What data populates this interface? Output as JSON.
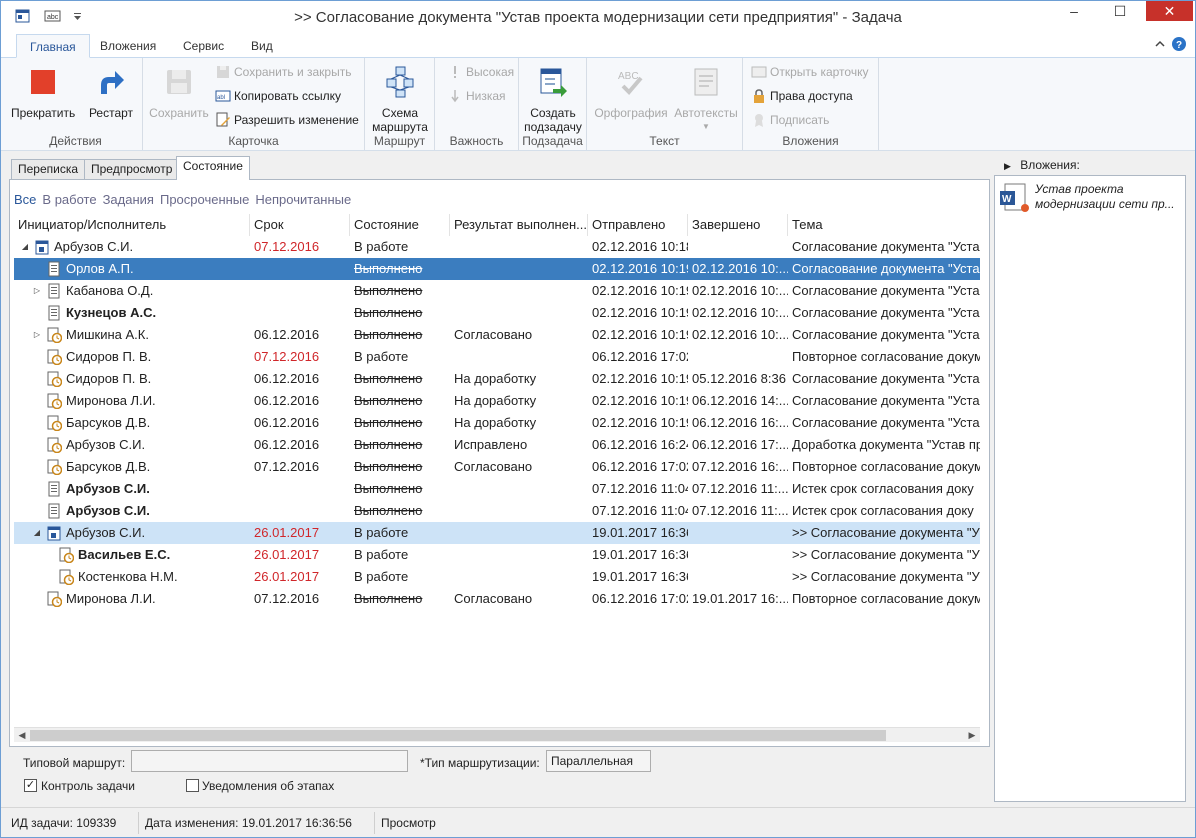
{
  "window": {
    "title": ">> Согласование документа \"Устав проекта модернизации сети предприятия\" - Задача",
    "minimize": "–",
    "maximize": "☐",
    "close": "✕"
  },
  "ribbon_tabs": [
    "Главная",
    "Вложения",
    "Сервис",
    "Вид"
  ],
  "ribbon": {
    "groups": {
      "actions": "Действия",
      "card": "Карточка",
      "route": "Маршрут",
      "importance": "Важность",
      "subtask": "Подзадача",
      "text": "Текст",
      "attachments": "Вложения"
    },
    "stop": "Прекратить",
    "restart": "Рестарт",
    "save": "Сохранить",
    "save_close": "Сохранить и закрыть",
    "copy_link": "Копировать ссылку",
    "allow_change": "Разрешить изменение",
    "route_scheme_1": "Схема",
    "route_scheme_2": "маршрута",
    "high": "Высокая",
    "low": "Низкая",
    "create_sub_1": "Создать",
    "create_sub_2": "подзадачу",
    "spelling": "Орфография",
    "autotext": "Автотексты",
    "open_card": "Открыть карточку",
    "access": "Права доступа",
    "sign": "Подписать"
  },
  "doc_tabs": [
    "Переписка",
    "Предпросмотр",
    "Состояние"
  ],
  "filters": [
    "Все",
    "В работе",
    "Задания",
    "Просроченные",
    "Непрочитанные"
  ],
  "columns": [
    "Инициатор/Исполнитель",
    "Срок",
    "Состояние",
    "Результат выполнен...",
    "Отправлено",
    "Завершено",
    "Тема"
  ],
  "rows": [
    {
      "name": "Арбузов С.И.",
      "due": "07.12.2016",
      "due_red": true,
      "state": "В работе",
      "strike": false,
      "result": "",
      "sent": "02.12.2016 10:18",
      "done": "",
      "subject": "Согласование документа \"Устав",
      "bold": false,
      "level": 0,
      "exp": "◢",
      "icon": "task-start",
      "style": ""
    },
    {
      "name": "Орлов А.П.",
      "due": "",
      "due_red": false,
      "state": "Выполнено",
      "strike": true,
      "result": "",
      "sent": "02.12.2016 10:19",
      "done": "02.12.2016 10:...",
      "subject": "Согласование документа \"Устав",
      "bold": false,
      "level": 1,
      "exp": "",
      "icon": "doc",
      "style": "sel"
    },
    {
      "name": "Кабанова О.Д.",
      "due": "",
      "due_red": false,
      "state": "Выполнено",
      "strike": true,
      "result": "",
      "sent": "02.12.2016 10:19",
      "done": "02.12.2016 10:...",
      "subject": "Согласование документа \"Устав",
      "bold": false,
      "level": 1,
      "exp": "▷",
      "icon": "doc",
      "style": ""
    },
    {
      "name": "Кузнецов А.С.",
      "due": "",
      "due_red": false,
      "state": "Выполнено",
      "strike": true,
      "result": "",
      "sent": "02.12.2016 10:19",
      "done": "02.12.2016 10:...",
      "subject": "Согласование документа \"Устав",
      "bold": true,
      "level": 1,
      "exp": "",
      "icon": "doc",
      "style": ""
    },
    {
      "name": "Мишкина А.К.",
      "due": "06.12.2016",
      "due_red": false,
      "state": "Выполнено",
      "strike": true,
      "result": "Согласовано",
      "sent": "02.12.2016 10:19",
      "done": "02.12.2016 10:...",
      "subject": "Согласование документа \"Устав",
      "bold": false,
      "level": 1,
      "exp": "▷",
      "icon": "clock",
      "style": ""
    },
    {
      "name": "Сидоров П. В.",
      "due": "07.12.2016",
      "due_red": true,
      "state": "В работе",
      "strike": false,
      "result": "",
      "sent": "06.12.2016 17:02",
      "done": "",
      "subject": "Повторное согласование докум",
      "bold": false,
      "level": 1,
      "exp": "",
      "icon": "clock",
      "style": ""
    },
    {
      "name": "Сидоров П. В.",
      "due": "06.12.2016",
      "due_red": false,
      "state": "Выполнено",
      "strike": true,
      "result": "На доработку",
      "sent": "02.12.2016 10:19",
      "done": "05.12.2016 8:36",
      "subject": "Согласование документа \"Устав",
      "bold": false,
      "level": 1,
      "exp": "",
      "icon": "clock",
      "style": ""
    },
    {
      "name": "Миронова Л.И.",
      "due": "06.12.2016",
      "due_red": false,
      "state": "Выполнено",
      "strike": true,
      "result": "На доработку",
      "sent": "02.12.2016 10:19",
      "done": "06.12.2016 14:...",
      "subject": "Согласование документа \"Устав",
      "bold": false,
      "level": 1,
      "exp": "",
      "icon": "clock",
      "style": ""
    },
    {
      "name": "Барсуков Д.В.",
      "due": "06.12.2016",
      "due_red": false,
      "state": "Выполнено",
      "strike": true,
      "result": "На доработку",
      "sent": "02.12.2016 10:19",
      "done": "06.12.2016 16:...",
      "subject": "Согласование документа \"Устав",
      "bold": false,
      "level": 1,
      "exp": "",
      "icon": "clock",
      "style": ""
    },
    {
      "name": "Арбузов С.И.",
      "due": "06.12.2016",
      "due_red": false,
      "state": "Выполнено",
      "strike": true,
      "result": "Исправлено",
      "sent": "06.12.2016 16:24",
      "done": "06.12.2016 17:...",
      "subject": "Доработка документа \"Устав пр",
      "bold": false,
      "level": 1,
      "exp": "",
      "icon": "clock",
      "style": ""
    },
    {
      "name": "Барсуков Д.В.",
      "due": "07.12.2016",
      "due_red": false,
      "state": "Выполнено",
      "strike": true,
      "result": "Согласовано",
      "sent": "06.12.2016 17:02",
      "done": "07.12.2016 16:...",
      "subject": "Повторное согласование докум",
      "bold": false,
      "level": 1,
      "exp": "",
      "icon": "clock",
      "style": ""
    },
    {
      "name": "Арбузов С.И.",
      "due": "",
      "due_red": false,
      "state": "Выполнено",
      "strike": true,
      "result": "",
      "sent": "07.12.2016 11:04",
      "done": "07.12.2016 11:...",
      "subject": "Истек срок согласования доку",
      "bold": true,
      "level": 1,
      "exp": "",
      "icon": "doc",
      "style": ""
    },
    {
      "name": "Арбузов С.И.",
      "due": "",
      "due_red": false,
      "state": "Выполнено",
      "strike": true,
      "result": "",
      "sent": "07.12.2016 11:04",
      "done": "07.12.2016 11:...",
      "subject": "Истек срок согласования доку",
      "bold": true,
      "level": 1,
      "exp": "",
      "icon": "doc",
      "style": ""
    },
    {
      "name": "Арбузов С.И.",
      "due": "26.01.2017",
      "due_red": true,
      "state": "В работе",
      "strike": false,
      "result": "",
      "sent": "19.01.2017 16:36",
      "done": "",
      "subject": ">> Согласование документа \"У",
      "bold": false,
      "level": 1,
      "exp": "◢",
      "icon": "task-start",
      "style": "hl"
    },
    {
      "name": "Васильев Е.С.",
      "due": "26.01.2017",
      "due_red": true,
      "state": "В работе",
      "strike": false,
      "result": "",
      "sent": "19.01.2017 16:36",
      "done": "",
      "subject": ">> Согласование документа \"У",
      "bold": true,
      "level": 2,
      "exp": "",
      "icon": "clock",
      "style": ""
    },
    {
      "name": "Костенкова Н.М.",
      "due": "26.01.2017",
      "due_red": true,
      "state": "В работе",
      "strike": false,
      "result": "",
      "sent": "19.01.2017 16:36",
      "done": "",
      "subject": ">> Согласование документа \"У",
      "bold": false,
      "level": 2,
      "exp": "",
      "icon": "clock",
      "style": ""
    },
    {
      "name": "Миронова Л.И.",
      "due": "07.12.2016",
      "due_red": false,
      "state": "Выполнено",
      "strike": true,
      "result": "Согласовано",
      "sent": "06.12.2016 17:02",
      "done": "19.01.2017 16:...",
      "subject": "Повторное согласование докум",
      "bold": false,
      "level": 1,
      "exp": "",
      "icon": "clock",
      "style": ""
    }
  ],
  "form": {
    "route_label": "Типовой маршрут:",
    "route_value": "",
    "routing_type_label": "*Тип маршрутизации:",
    "routing_type_value": "Параллельная",
    "control_label": "Контроль задачи",
    "control_checked": true,
    "notify_label": "Уведомления об этапах",
    "notify_checked": false
  },
  "attachments_panel": {
    "header": "Вложения:",
    "item_line1": "Устав проекта",
    "item_line2": "модернизации сети пр..."
  },
  "status": {
    "task_id": "ИД задачи: 109339",
    "modified": "Дата изменения: 19.01.2017 16:36:56",
    "mode": "Просмотр"
  },
  "colors": {
    "selected_row": "#3b7dbf",
    "highlight_row": "#cde3f7",
    "overdue": "#d0262a",
    "close_button": "#c7312a"
  }
}
